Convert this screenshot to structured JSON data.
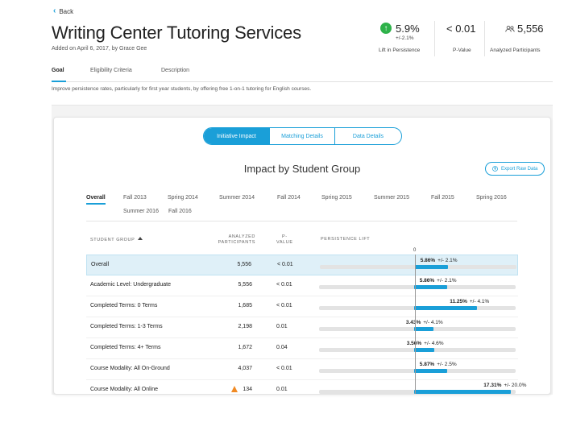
{
  "back_label": "Back",
  "title": "Writing Center Tutoring Services",
  "subtitle": "Added on April 6, 2017, by Grace Gee",
  "stats": {
    "lift_value": "5.9%",
    "lift_sub": "+/-2.1%",
    "lift_label": "Lift in Persistence",
    "pvalue_value": "< 0.01",
    "pvalue_label": "P-Value",
    "participants_value": "5,556",
    "participants_label": "Analyzed Participants",
    "accent_color": "#2eb24a"
  },
  "tabs": [
    {
      "label": "Goal"
    },
    {
      "label": "Eligibility Criteria"
    },
    {
      "label": "Description"
    }
  ],
  "goal_text": "Improve persistence rates, particularly for first year students, by offering free 1-on-1 tutoring for English courses.",
  "view_toggle": {
    "initiative": "Initiative Impact",
    "matching": "Matching Details",
    "data": "Data Details"
  },
  "card_title": "Impact by Student Group",
  "export_label": "Export Raw Data",
  "terms": [
    "Overall",
    "Fall 2013",
    "Spring 2014",
    "Summer 2014",
    "Fall 2014",
    "Spring 2015",
    "Summer 2015",
    "Fall 2015",
    "Spring 2016",
    "Summer 2016",
    "Fall 2016"
  ],
  "table": {
    "headers": {
      "group": "Student Group",
      "participants_l1": "Analyzed",
      "participants_l2": "Participants",
      "pvalue_l1": "P-",
      "pvalue_l2": "Value",
      "lift": "Persistence Lift"
    },
    "zero_label": "0",
    "rows": [
      {
        "group": "Overall",
        "participants": "5,556",
        "pvalue": "< 0.01",
        "lift": 5.86,
        "lift_text": "5.86%",
        "err": "+/- 2.1%",
        "warning": false
      },
      {
        "group": "Academic Level: Undergraduate",
        "participants": "5,556",
        "pvalue": "< 0.01",
        "lift": 5.86,
        "lift_text": "5.86%",
        "err": "+/- 2.1%",
        "warning": false
      },
      {
        "group": "Completed Terms: 0 Terms",
        "participants": "1,685",
        "pvalue": "< 0.01",
        "lift": 11.25,
        "lift_text": "11.25%",
        "err": "+/- 4.1%",
        "warning": false
      },
      {
        "group": "Completed Terms: 1-3 Terms",
        "participants": "2,198",
        "pvalue": "0.01",
        "lift": 3.43,
        "lift_text": "3.43%",
        "err": "+/- 4.1%",
        "warning": false
      },
      {
        "group": "Completed Terms: 4+ Terms",
        "participants": "1,672",
        "pvalue": "0.04",
        "lift": 3.56,
        "lift_text": "3.56%",
        "err": "+/- 4.6%",
        "warning": false
      },
      {
        "group": "Course Modality: All On-Ground",
        "participants": "4,037",
        "pvalue": "< 0.01",
        "lift": 5.87,
        "lift_text": "5.87%",
        "err": "+/- 2.5%",
        "warning": false
      },
      {
        "group": "Course Modality: All Online",
        "participants": "134",
        "pvalue": "0.01",
        "lift": 17.31,
        "lift_text": "17.31%",
        "err": "+/- 20.0%",
        "warning": true
      }
    ]
  },
  "colors": {
    "accent": "#1a9fd8",
    "highlight_row": "#dff0f8",
    "warning": "#f08a24"
  }
}
